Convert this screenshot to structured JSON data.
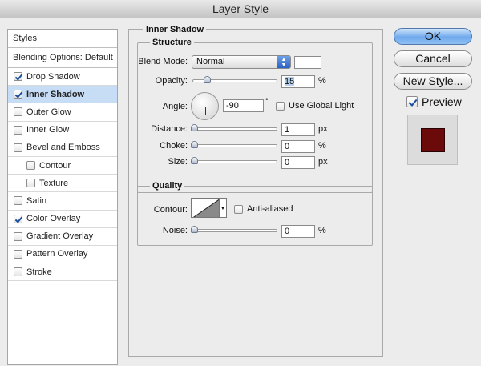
{
  "window": {
    "title": "Layer Style"
  },
  "styles_panel": {
    "header": "Styles",
    "blending_options": "Blending Options: Default",
    "items": [
      {
        "label": "Drop Shadow",
        "checked": true,
        "selected": false,
        "indent": false
      },
      {
        "label": "Inner Shadow",
        "checked": true,
        "selected": true,
        "indent": false
      },
      {
        "label": "Outer Glow",
        "checked": false,
        "selected": false,
        "indent": false
      },
      {
        "label": "Inner Glow",
        "checked": false,
        "selected": false,
        "indent": false
      },
      {
        "label": "Bevel and Emboss",
        "checked": false,
        "selected": false,
        "indent": false
      },
      {
        "label": "Contour",
        "checked": false,
        "selected": false,
        "indent": true
      },
      {
        "label": "Texture",
        "checked": false,
        "selected": false,
        "indent": true
      },
      {
        "label": "Satin",
        "checked": false,
        "selected": false,
        "indent": false
      },
      {
        "label": "Color Overlay",
        "checked": true,
        "selected": false,
        "indent": false
      },
      {
        "label": "Gradient Overlay",
        "checked": false,
        "selected": false,
        "indent": false
      },
      {
        "label": "Pattern Overlay",
        "checked": false,
        "selected": false,
        "indent": false
      },
      {
        "label": "Stroke",
        "checked": false,
        "selected": false,
        "indent": false
      }
    ]
  },
  "inner_shadow": {
    "title": "Inner Shadow",
    "structure": {
      "title": "Structure",
      "blend_mode_label": "Blend Mode:",
      "blend_mode_value": "Normal",
      "opacity_label": "Opacity:",
      "opacity_value": "15",
      "opacity_unit": "%",
      "opacity_fraction": 0.15,
      "angle_label": "Angle:",
      "angle_value": "-90",
      "angle_unit": "°",
      "use_global_light_label": "Use Global Light",
      "use_global_light_checked": false,
      "distance_label": "Distance:",
      "distance_value": "1",
      "distance_unit": "px",
      "choke_label": "Choke:",
      "choke_value": "0",
      "choke_unit": "%",
      "size_label": "Size:",
      "size_value": "0",
      "size_unit": "px"
    },
    "quality": {
      "title": "Quality",
      "contour_label": "Contour:",
      "anti_aliased_label": "Anti-aliased",
      "anti_aliased_checked": false,
      "noise_label": "Noise:",
      "noise_value": "0",
      "noise_unit": "%"
    }
  },
  "buttons": {
    "ok": "OK",
    "cancel": "Cancel",
    "new_style": "New Style...",
    "preview_label": "Preview",
    "preview_checked": true
  },
  "colors": {
    "preview_swatch": "#6b0a0a",
    "selection": "#c7dcf5",
    "accent": "#2a62c6"
  }
}
